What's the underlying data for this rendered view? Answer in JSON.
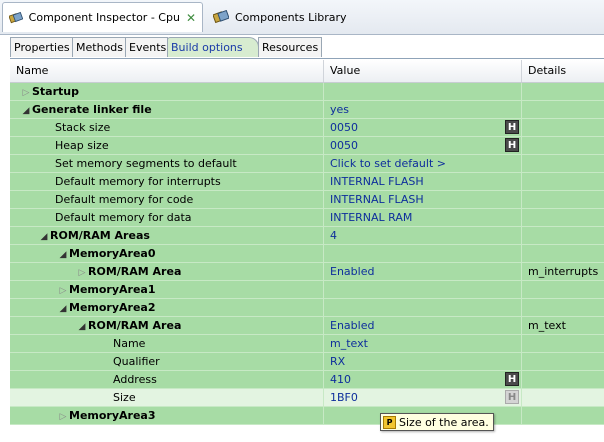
{
  "editor_tabs": [
    {
      "label": "Component Inspector - Cpu",
      "active": true
    },
    {
      "label": "Components Library",
      "active": false
    }
  ],
  "inner_tabs": [
    {
      "label": "Properties",
      "active": false
    },
    {
      "label": "Methods",
      "active": false
    },
    {
      "label": "Events",
      "active": false
    },
    {
      "label": "Build options",
      "active": true
    },
    {
      "label": "Resources",
      "active": false
    }
  ],
  "columns": {
    "name": "Name",
    "value": "Value",
    "details": "Details"
  },
  "rows": [
    {
      "name": "Startup",
      "value": "",
      "details": ""
    },
    {
      "name": "Generate linker file",
      "value": "yes",
      "details": ""
    },
    {
      "name": "Stack size",
      "value": "0050",
      "details": ""
    },
    {
      "name": "Heap size",
      "value": "0050",
      "details": ""
    },
    {
      "name": "Set memory segments to default",
      "value": "Click to set default >",
      "details": ""
    },
    {
      "name": "Default memory for interrupts",
      "value": "INTERNAL FLASH",
      "details": ""
    },
    {
      "name": "Default memory for code",
      "value": "INTERNAL FLASH",
      "details": ""
    },
    {
      "name": "Default memory for data",
      "value": "INTERNAL RAM",
      "details": ""
    },
    {
      "name": "ROM/RAM Areas",
      "value": "4",
      "details": ""
    },
    {
      "name": "MemoryArea0",
      "value": "",
      "details": ""
    },
    {
      "name": "ROM/RAM Area",
      "value": "Enabled",
      "details": "m_interrupts"
    },
    {
      "name": "MemoryArea1",
      "value": "",
      "details": ""
    },
    {
      "name": "MemoryArea2",
      "value": "",
      "details": ""
    },
    {
      "name": "ROM/RAM Area",
      "value": "Enabled",
      "details": "m_text"
    },
    {
      "name": "Name",
      "value": "m_text",
      "details": ""
    },
    {
      "name": "Qualifier",
      "value": "RX",
      "details": ""
    },
    {
      "name": "Address",
      "value": "410",
      "details": ""
    },
    {
      "name": "Size",
      "value": "1BF0",
      "details": ""
    },
    {
      "name": "MemoryArea3",
      "value": "",
      "details": ""
    }
  ],
  "h_button_label": "H",
  "tooltip": {
    "badge": "P",
    "text": "Size of the area."
  }
}
